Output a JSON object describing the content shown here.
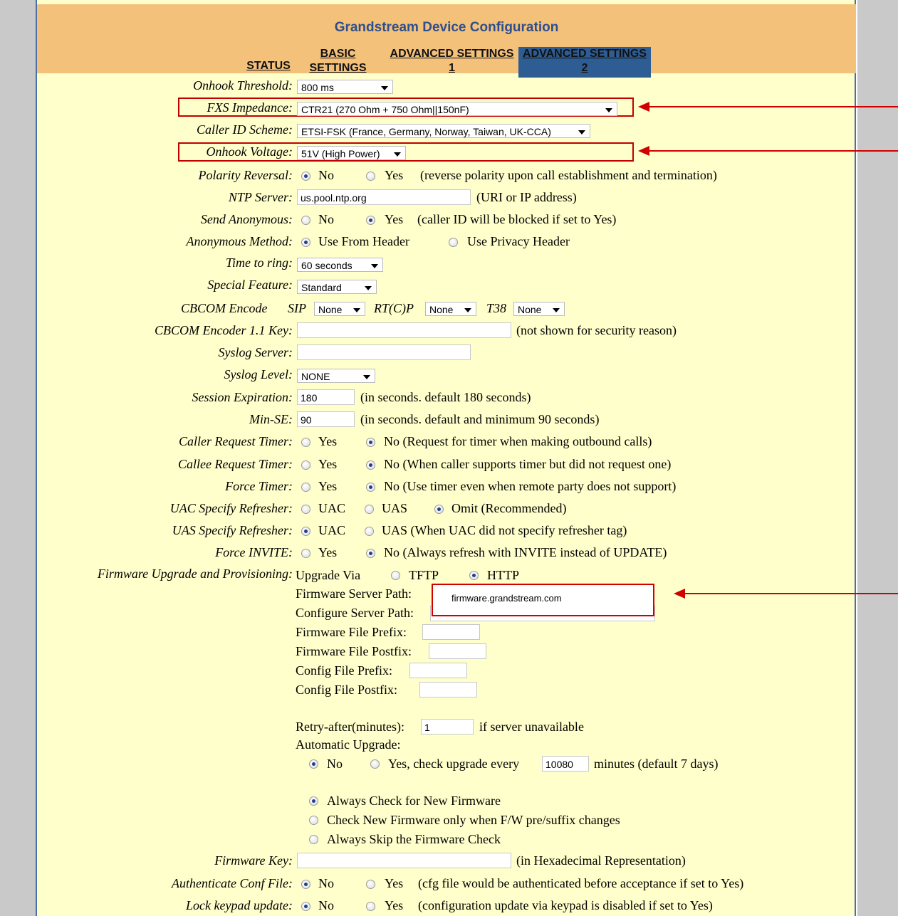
{
  "title": "Grandstream Device Configuration",
  "tabs": {
    "status": "STATUS",
    "basic": "BASIC SETTINGS",
    "adv1": "ADVANCED SETTINGS 1",
    "adv2": "ADVANCED SETTINGS 2"
  },
  "fields": {
    "onhook_threshold": {
      "label": "Onhook Threshold:",
      "value": "800 ms"
    },
    "fxs_impedance": {
      "label": "FXS Impedance:",
      "value": "CTR21 (270 Ohm + 750 Ohm||150nF)"
    },
    "caller_id": {
      "label": "Caller ID Scheme:",
      "value": "ETSI-FSK (France, Germany, Norway, Taiwan, UK-CCA)"
    },
    "onhook_voltage": {
      "label": "Onhook Voltage:",
      "value": "51V (High Power)"
    },
    "polarity": {
      "label": "Polarity Reversal:",
      "no": "No",
      "yes": "Yes",
      "note": "(reverse polarity upon call establishment and termination)"
    },
    "ntp": {
      "label": "NTP Server:",
      "value": "us.pool.ntp.org",
      "note": "(URI or IP address)"
    },
    "send_anon": {
      "label": "Send Anonymous:",
      "no": "No",
      "yes": "Yes",
      "note": "(caller ID will be blocked if set to Yes)"
    },
    "anon_method": {
      "label": "Anonymous Method:",
      "opt1": "Use From Header",
      "opt2": "Use Privacy Header"
    },
    "time_to_ring": {
      "label": "Time to ring:",
      "value": "60 seconds"
    },
    "special_feature": {
      "label": "Special Feature:",
      "value": "Standard"
    },
    "cbcom": {
      "label": "CBCOM Encode",
      "sip": "SIP",
      "sip_val": "None",
      "rtcp": "RT(C)P",
      "rtcp_val": "None",
      "t38": "T38",
      "t38_val": "None"
    },
    "cbcom_key": {
      "label": "CBCOM Encoder 1.1 Key:",
      "note": "(not shown for security reason)"
    },
    "syslog_server": {
      "label": "Syslog Server:"
    },
    "syslog_level": {
      "label": "Syslog Level:",
      "value": "NONE"
    },
    "session_exp": {
      "label": "Session Expiration:",
      "value": "180",
      "note": "(in seconds. default 180 seconds)"
    },
    "min_se": {
      "label": "Min-SE:",
      "value": "90",
      "note": "(in seconds. default and minimum 90 seconds)"
    },
    "caller_timer": {
      "label": "Caller Request Timer:",
      "yes": "Yes",
      "no": "No (Request for timer when making outbound calls)"
    },
    "callee_timer": {
      "label": "Callee Request Timer:",
      "yes": "Yes",
      "no": "No (When caller supports timer but did not request one)"
    },
    "force_timer": {
      "label": "Force Timer:",
      "yes": "Yes",
      "no": "No (Use timer even when remote party does not support)"
    },
    "uac_refresher": {
      "label": "UAC Specify Refresher:",
      "uac": "UAC",
      "uas": "UAS",
      "omit": "Omit (Recommended)"
    },
    "uas_refresher": {
      "label": "UAS Specify Refresher:",
      "uac": "UAC",
      "uas": "UAS (When UAC did not specify refresher tag)"
    },
    "force_invite": {
      "label": "Force INVITE:",
      "yes": "Yes",
      "no": "No (Always refresh with INVITE instead of UPDATE)"
    },
    "firmware": {
      "label": "Firmware Upgrade and Provisioning:",
      "upgrade_via": "Upgrade Via",
      "tftp": "TFTP",
      "http": "HTTP",
      "fw_server_path": "Firmware Server Path:",
      "cfg_server_path": "Configure Server Path:",
      "fw_prefix": "Firmware File Prefix:",
      "fw_postfix": "Firmware File Postfix:",
      "cfg_prefix": "Config File Prefix:",
      "cfg_postfix": "Config File Postfix:",
      "retry": "Retry-after(minutes):",
      "retry_val": "1",
      "retry_note": "if server unavailable",
      "auto_upgrade": "Automatic Upgrade:",
      "auto_no": "No",
      "auto_yes": "Yes, check upgrade every",
      "auto_val": "10080",
      "auto_note": "minutes (default 7 days)",
      "always_check": "Always Check for New Firmware",
      "check_when": "Check New Firmware only when F/W pre/suffix changes",
      "always_skip": "Always Skip the Firmware Check"
    },
    "firmware_key": {
      "label": "Firmware Key:",
      "note": "(in Hexadecimal Representation)"
    },
    "auth_conf": {
      "label": "Authenticate Conf File:",
      "no": "No",
      "yes": "Yes",
      "note": "(cfg file would be authenticated before acceptance if set to Yes)"
    },
    "lock_keypad": {
      "label": "Lock keypad update:",
      "no": "No",
      "yes": "Yes",
      "note": "(configuration update via keypad is disabled if set to Yes)"
    }
  },
  "callout": {
    "text": "firmware.grandstream.com"
  },
  "colors": {
    "header": "#f4c17b",
    "panel": "#ffffcc",
    "title": "#2e4f8c",
    "highlight": "#c00000"
  }
}
